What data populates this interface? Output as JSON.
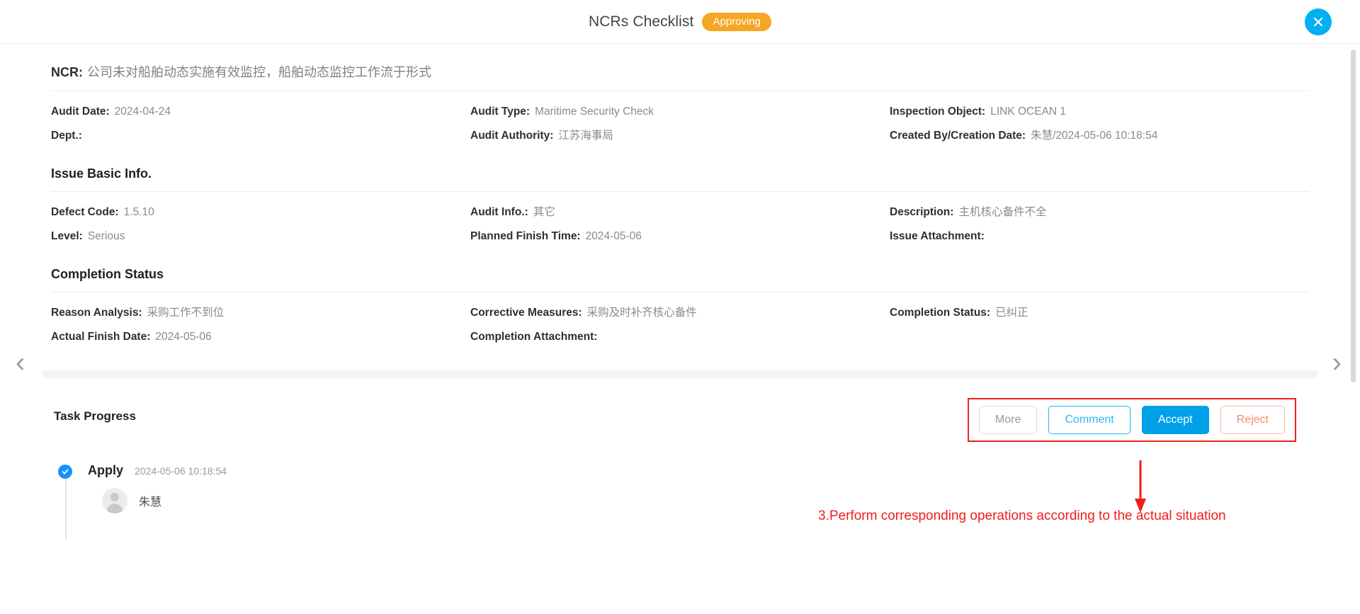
{
  "header": {
    "title": "NCRs Checklist",
    "status_badge": "Approving",
    "close_icon": "close-icon"
  },
  "ncr": {
    "label": "NCR:",
    "value": "公司未对船舶动态实施有效监控，船舶动态监控工作流于形式"
  },
  "overview": {
    "fields": [
      {
        "label": "Audit Date:",
        "value": "2024-04-24"
      },
      {
        "label": "Audit Type:",
        "value": "Maritime Security Check"
      },
      {
        "label": "Inspection Object:",
        "value": "LINK OCEAN 1"
      },
      {
        "label": "Dept.:",
        "value": ""
      },
      {
        "label": "Audit Authority:",
        "value": "江苏海事局"
      },
      {
        "label": "Created By/Creation Date:",
        "value": "朱慧/2024-05-06 10:18:54"
      }
    ]
  },
  "issue_basic_info": {
    "title": "Issue Basic Info.",
    "fields": [
      {
        "label": "Defect Code:",
        "value": "1.5.10"
      },
      {
        "label": "Audit Info.:",
        "value": "其它"
      },
      {
        "label": "Description:",
        "value": "主机核心备件不全"
      },
      {
        "label": "Level:",
        "value": "Serious"
      },
      {
        "label": "Planned Finish Time:",
        "value": "2024-05-06"
      },
      {
        "label": "Issue Attachment:",
        "value": ""
      }
    ]
  },
  "completion_status": {
    "title": "Completion Status",
    "fields": [
      {
        "label": "Reason Analysis:",
        "value": "采购工作不到位"
      },
      {
        "label": "Corrective Measures:",
        "value": "采购及时补齐核心备件"
      },
      {
        "label": "Completion Status:",
        "value": "已纠正"
      },
      {
        "label": "Actual Finish Date:",
        "value": "2024-05-06"
      },
      {
        "label": "Completion Attachment:",
        "value": ""
      },
      {
        "label": "",
        "value": ""
      }
    ]
  },
  "task_progress": {
    "title": "Task Progress",
    "actions": [
      {
        "name": "more",
        "label": "More"
      },
      {
        "name": "comment",
        "label": "Comment"
      },
      {
        "name": "accept",
        "label": "Accept"
      },
      {
        "name": "reject",
        "label": "Reject"
      }
    ],
    "timeline": [
      {
        "step": "Apply",
        "time": "2024-05-06 10:18:54",
        "user": "朱慧"
      }
    ]
  },
  "annotation": {
    "text": "3.Perform corresponding operations according to the actual situation",
    "color": "#f01d1d"
  },
  "nav": {
    "prev_icon": "chevron-left-icon",
    "next_icon": "chevron-right-icon"
  },
  "colors": {
    "accent_blue": "#00a0e9",
    "badge_orange": "#f5a623",
    "annotation_red": "#f01d1d",
    "reject_orange": "#f98a6c"
  }
}
